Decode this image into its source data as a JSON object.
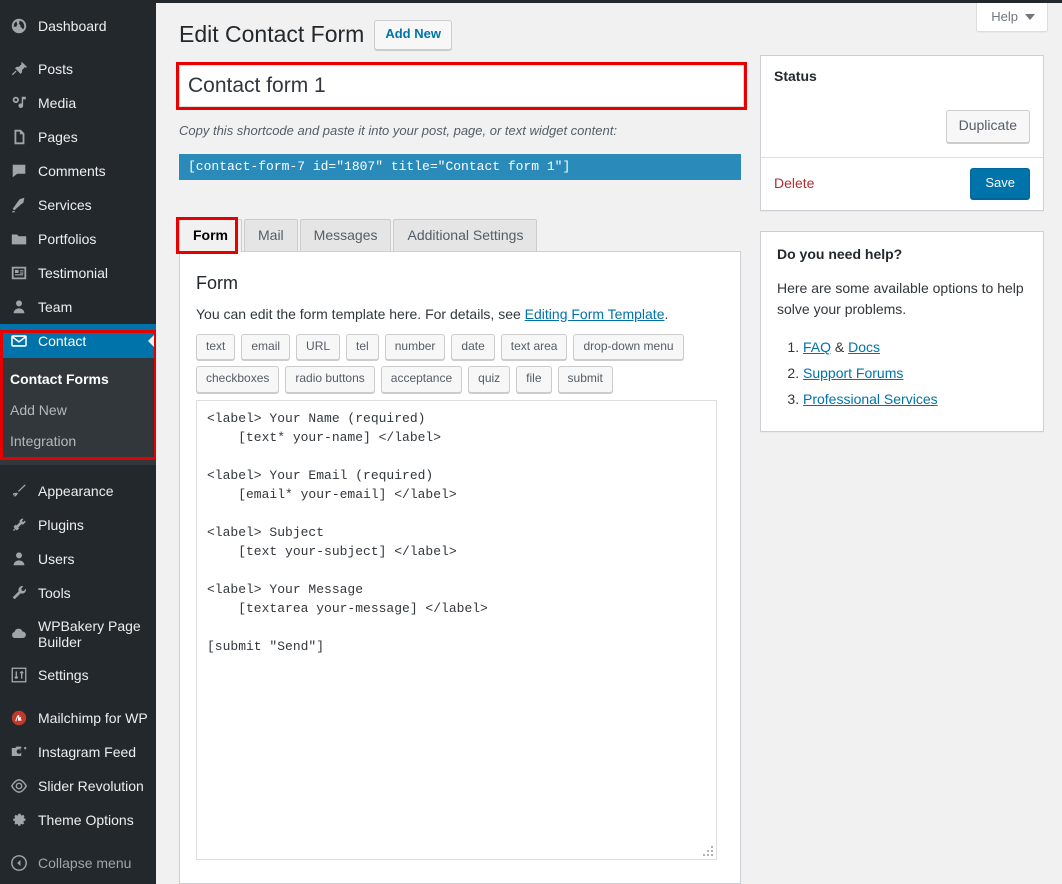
{
  "sidebar": {
    "items": [
      {
        "label": "Dashboard",
        "icon": "dashboard-icon",
        "state": "normal"
      },
      {
        "label": "Posts",
        "icon": "pin-icon",
        "state": "normal"
      },
      {
        "label": "Media",
        "icon": "media-icon",
        "state": "normal"
      },
      {
        "label": "Pages",
        "icon": "pages-icon",
        "state": "normal"
      },
      {
        "label": "Comments",
        "icon": "comments-icon",
        "state": "normal"
      },
      {
        "label": "Services",
        "icon": "hammer-icon",
        "state": "normal"
      },
      {
        "label": "Portfolios",
        "icon": "portfolio-icon",
        "state": "normal"
      },
      {
        "label": "Testimonial",
        "icon": "id-card-icon",
        "state": "normal"
      },
      {
        "label": "Team",
        "icon": "user-icon",
        "state": "normal"
      },
      {
        "label": "Contact",
        "icon": "envelope-icon",
        "state": "active"
      },
      {
        "label": "Appearance",
        "icon": "brush-icon",
        "state": "normal"
      },
      {
        "label": "Plugins",
        "icon": "plugin-icon",
        "state": "normal"
      },
      {
        "label": "Users",
        "icon": "users-icon",
        "state": "normal"
      },
      {
        "label": "Tools",
        "icon": "wrench-icon",
        "state": "normal"
      },
      {
        "label": "WPBakery Page Builder",
        "icon": "cloud-icon",
        "state": "normal"
      },
      {
        "label": "Settings",
        "icon": "sliders-icon",
        "state": "normal"
      },
      {
        "label": "Mailchimp for WP",
        "icon": "mailchimp-icon",
        "state": "normal"
      },
      {
        "label": "Instagram Feed",
        "icon": "camera-icon",
        "state": "normal"
      },
      {
        "label": "Slider Revolution",
        "icon": "slider-icon",
        "state": "normal"
      },
      {
        "label": "Theme Options",
        "icon": "gear-icon",
        "state": "normal"
      },
      {
        "label": "Collapse menu",
        "icon": "collapse-icon",
        "state": "dim"
      }
    ],
    "submenu": [
      {
        "label": "Contact Forms",
        "current": true
      },
      {
        "label": "Add New",
        "current": false
      },
      {
        "label": "Integration",
        "current": false
      }
    ],
    "active_accent": "#0073aa",
    "background": "#23282d",
    "submenu_background": "#32373c"
  },
  "header": {
    "help_label": "Help",
    "page_title": "Edit Contact Form",
    "add_new_label": "Add New"
  },
  "form_title": {
    "value": "Contact form 1",
    "placeholder": "Enter title here"
  },
  "shortcode": {
    "help_text": "Copy this shortcode and paste it into your post, page, or text widget content:",
    "value": "[contact-form-7 id=\"1807\" title=\"Contact form 1\"]",
    "bar_color": "#2a8bbb"
  },
  "tabs": [
    {
      "label": "Form",
      "active": true
    },
    {
      "label": "Mail",
      "active": false
    },
    {
      "label": "Messages",
      "active": false
    },
    {
      "label": "Additional Settings",
      "active": false
    }
  ],
  "form_panel": {
    "heading": "Form",
    "description_before": "You can edit the form template here. For details, see ",
    "description_link": "Editing Form Template",
    "description_after": ".",
    "tag_row_1": [
      "text",
      "email",
      "URL",
      "tel",
      "number",
      "date",
      "text area",
      "drop-down menu"
    ],
    "tag_row_2": [
      "checkboxes",
      "radio buttons",
      "acceptance",
      "quiz",
      "file",
      "submit"
    ],
    "template": "<label> Your Name (required)\n    [text* your-name] </label>\n\n<label> Your Email (required)\n    [email* your-email] </label>\n\n<label> Subject\n    [text your-subject] </label>\n\n<label> Your Message\n    [textarea your-message] </label>\n\n[submit \"Send\"]"
  },
  "status_box": {
    "title": "Status",
    "duplicate_label": "Duplicate",
    "delete_label": "Delete",
    "save_label": "Save",
    "save_color": "#0073aa",
    "delete_color": "#b32d2e"
  },
  "help_box": {
    "title": "Do you need help?",
    "text": "Here are some available options to help solve your problems.",
    "items": [
      {
        "prefix": "",
        "link1": "FAQ",
        "middle": " & ",
        "link2": "Docs"
      },
      {
        "prefix": "",
        "link1": "Support Forums",
        "middle": "",
        "link2": ""
      },
      {
        "prefix": "",
        "link1": "Professional Services",
        "middle": "",
        "link2": ""
      }
    ]
  },
  "highlights": {
    "color": "#e60000",
    "targets": [
      "contact-menu",
      "form-title-input",
      "form-tab"
    ]
  }
}
